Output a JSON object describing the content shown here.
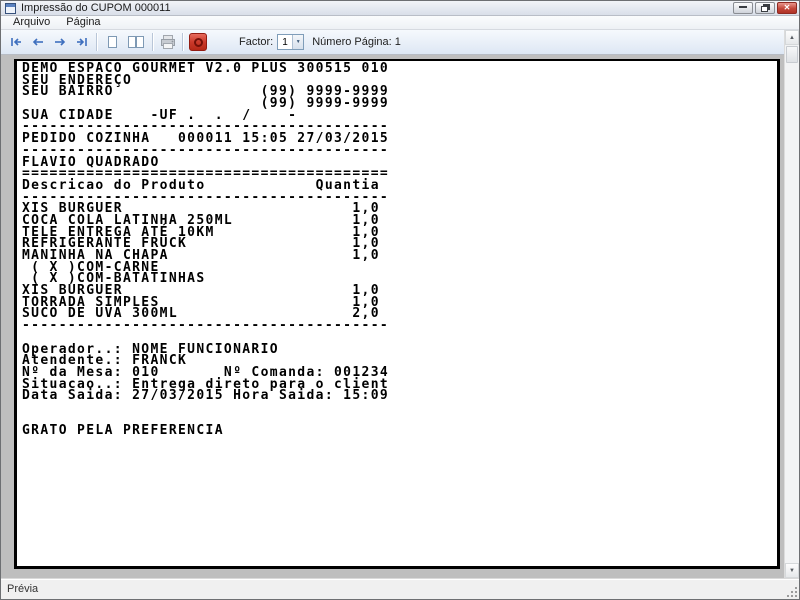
{
  "window": {
    "title": "Impressão do CUPOM 000011"
  },
  "menu": {
    "items": [
      "Arquivo",
      "Página"
    ]
  },
  "toolbar": {
    "factor_label": "Factor:",
    "factor_value": "1",
    "page_number_text": "Número Página: 1"
  },
  "receipt": {
    "lines": [
      "DEMO ESPACO GOURMET V2.0 PLUS 300515 010",
      "SEU ENDEREÇO",
      "SEU BAIRRO                (99) 9999-9999",
      "                          (99) 9999-9999",
      "SUA CIDADE    -UF .  .  /    -",
      "----------------------------------------",
      "PEDIDO COZINHA   000011 15:05 27/03/2015",
      "----------------------------------------",
      "FLAVIO QUADRADO",
      "========================================",
      "Descricao do Produto            Quantia",
      "----------------------------------------",
      "XIS BURGUER                         1,0",
      "COCA COLA LATINHA 250ML             1,0",
      "TELE ENTREGA ATÉ 10KM               1,0",
      "REFRIGERANTE FRUCK                  1,0",
      "MANINHA NA CHAPA                    1,0",
      " ( X )COM-CARNE",
      " ( X )COM-BATATINHAS",
      "XIS BURGUER                         1,0",
      "TORRADA SIMPLES                     1,0",
      "SUCO DE UVA 300ML                   2,0",
      "----------------------------------------",
      "",
      "Operador..: NOME FUNCIONARIO",
      "Atendente.: FRANCK",
      "Nº da Mesa: 010       Nº Comanda: 001234",
      "Situacao..: Entrega direto para o client",
      "Data Saida: 27/03/2015 Hora Saida: 15:09",
      "",
      "",
      "GRATO PELA PREFERENCIA"
    ]
  },
  "status": {
    "text": "Prévia"
  },
  "colors": {
    "toolbar_arrow_blue": "#3e6fbe",
    "exit_button_red": "#cb3a2b",
    "page_border": "#000000",
    "preview_background": "#bebebe"
  }
}
